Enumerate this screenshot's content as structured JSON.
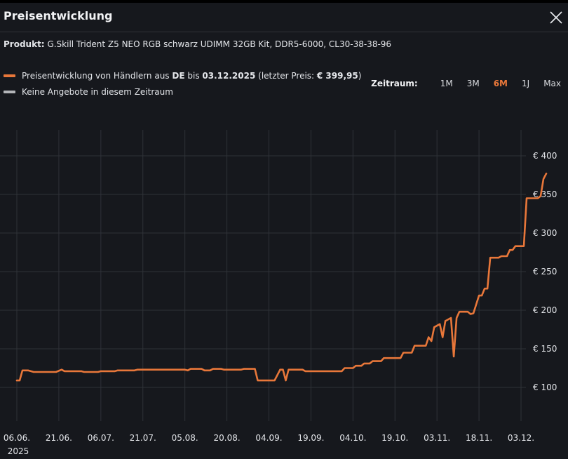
{
  "header": {
    "title": "Preisentwicklung"
  },
  "product": {
    "label": "Produkt:",
    "name": "G.Skill Trident Z5 NEO RGB schwarz UDIMM 32GB Kit, DDR5-6000, CL30-38-38-96"
  },
  "legend": {
    "series_text_1": "Preisentwicklung von Händlern aus ",
    "series_country": "DE",
    "series_text_2": " bis ",
    "series_date": "03.12.2025",
    "series_text_3": " (letzter Preis: ",
    "series_price": "€ 399,95",
    "series_text_4": ")",
    "no_offer": "Keine Angebote in diesem Zeitraum"
  },
  "range": {
    "label": "Zeitraum:",
    "options": [
      "1M",
      "3M",
      "6M",
      "1J",
      "Max"
    ],
    "active": "6M"
  },
  "colors": {
    "series": "#e8773a",
    "no_offer": "#b3b5b9",
    "accent": "#e8773a",
    "background": "#16181d",
    "grid": "#2f3238"
  },
  "chart_data": {
    "type": "line",
    "ylim": [
      85,
      410
    ],
    "y_ticks": [
      100,
      150,
      200,
      250,
      300,
      350,
      400
    ],
    "y_tick_labels": [
      "€ 100",
      "€ 150",
      "€ 200",
      "€ 250",
      "€ 300",
      "€ 350",
      "€ 400"
    ],
    "x_tick_labels": [
      "06.06.",
      "21.06.",
      "06.07.",
      "21.07.",
      "05.08.",
      "20.08.",
      "04.09.",
      "19.09.",
      "04.10.",
      "19.10.",
      "03.11.",
      "18.11.",
      "03.12."
    ],
    "x_tick_year": "2025",
    "grid": true,
    "x_domain": [
      "06.06.2025",
      "03.12.2025"
    ],
    "series": [
      {
        "values": [
          [
            "06.06.2025",
            109
          ],
          [
            "07.06.2025",
            109
          ],
          [
            "08.06.2025",
            122
          ],
          [
            "10.06.2025",
            122
          ],
          [
            "12.06.2025",
            120
          ],
          [
            "20.06.2025",
            120
          ],
          [
            "22.06.2025",
            123
          ],
          [
            "23.06.2025",
            121
          ],
          [
            "29.06.2025",
            121
          ],
          [
            "30.06.2025",
            120
          ],
          [
            "05.07.2025",
            120
          ],
          [
            "06.07.2025",
            121
          ],
          [
            "11.07.2025",
            121
          ],
          [
            "12.07.2025",
            122
          ],
          [
            "18.07.2025",
            122
          ],
          [
            "19.07.2025",
            123
          ],
          [
            "05.08.2025",
            123
          ],
          [
            "06.08.2025",
            122
          ],
          [
            "07.08.2025",
            124
          ],
          [
            "11.08.2025",
            124
          ],
          [
            "12.08.2025",
            122
          ],
          [
            "14.08.2025",
            122
          ],
          [
            "15.08.2025",
            124
          ],
          [
            "18.08.2025",
            124
          ],
          [
            "19.08.2025",
            123
          ],
          [
            "25.08.2025",
            123
          ],
          [
            "26.08.2025",
            124
          ],
          [
            "30.08.2025",
            124
          ],
          [
            "31.08.2025",
            109
          ],
          [
            "06.09.2025",
            109
          ],
          [
            "08.09.2025",
            123
          ],
          [
            "09.09.2025",
            123
          ],
          [
            "10.09.2025",
            109
          ],
          [
            "11.09.2025",
            123
          ],
          [
            "16.09.2025",
            123
          ],
          [
            "17.09.2025",
            121
          ],
          [
            "30.09.2025",
            121
          ],
          [
            "01.10.2025",
            125
          ],
          [
            "04.10.2025",
            125
          ],
          [
            "05.10.2025",
            128
          ],
          [
            "07.10.2025",
            128
          ],
          [
            "08.10.2025",
            131
          ],
          [
            "10.10.2025",
            131
          ],
          [
            "11.10.2025",
            134
          ],
          [
            "14.10.2025",
            134
          ],
          [
            "15.10.2025",
            138
          ],
          [
            "21.10.2025",
            138
          ],
          [
            "22.10.2025",
            145
          ],
          [
            "25.10.2025",
            145
          ],
          [
            "26.10.2025",
            154
          ],
          [
            "30.10.2025",
            154
          ],
          [
            "31.10.2025",
            165
          ],
          [
            "01.11.2025",
            160
          ],
          [
            "02.11.2025",
            178
          ],
          [
            "04.11.2025",
            182
          ],
          [
            "05.11.2025",
            165
          ],
          [
            "06.11.2025",
            186
          ],
          [
            "08.11.2025",
            190
          ],
          [
            "09.11.2025",
            140
          ],
          [
            "10.11.2025",
            190
          ],
          [
            "11.11.2025",
            198
          ],
          [
            "14.11.2025",
            198
          ],
          [
            "15.11.2025",
            195
          ],
          [
            "16.11.2025",
            196
          ],
          [
            "18.11.2025",
            219
          ],
          [
            "19.11.2025",
            219
          ],
          [
            "20.11.2025",
            228
          ],
          [
            "21.11.2025",
            228
          ],
          [
            "22.11.2025",
            268
          ],
          [
            "25.11.2025",
            268
          ],
          [
            "26.11.2025",
            270
          ],
          [
            "28.11.2025",
            270
          ],
          [
            "29.11.2025",
            278
          ],
          [
            "30.11.2025",
            278
          ],
          [
            "01.12.2025",
            283
          ],
          [
            "04.12.2025",
            283
          ],
          [
            "05.12.2025",
            345
          ],
          [
            "09.12.2025",
            345
          ],
          [
            "10.12.2025",
            348
          ],
          [
            "11.12.2025",
            370
          ],
          [
            "12.12.2025",
            377
          ]
        ]
      }
    ]
  }
}
